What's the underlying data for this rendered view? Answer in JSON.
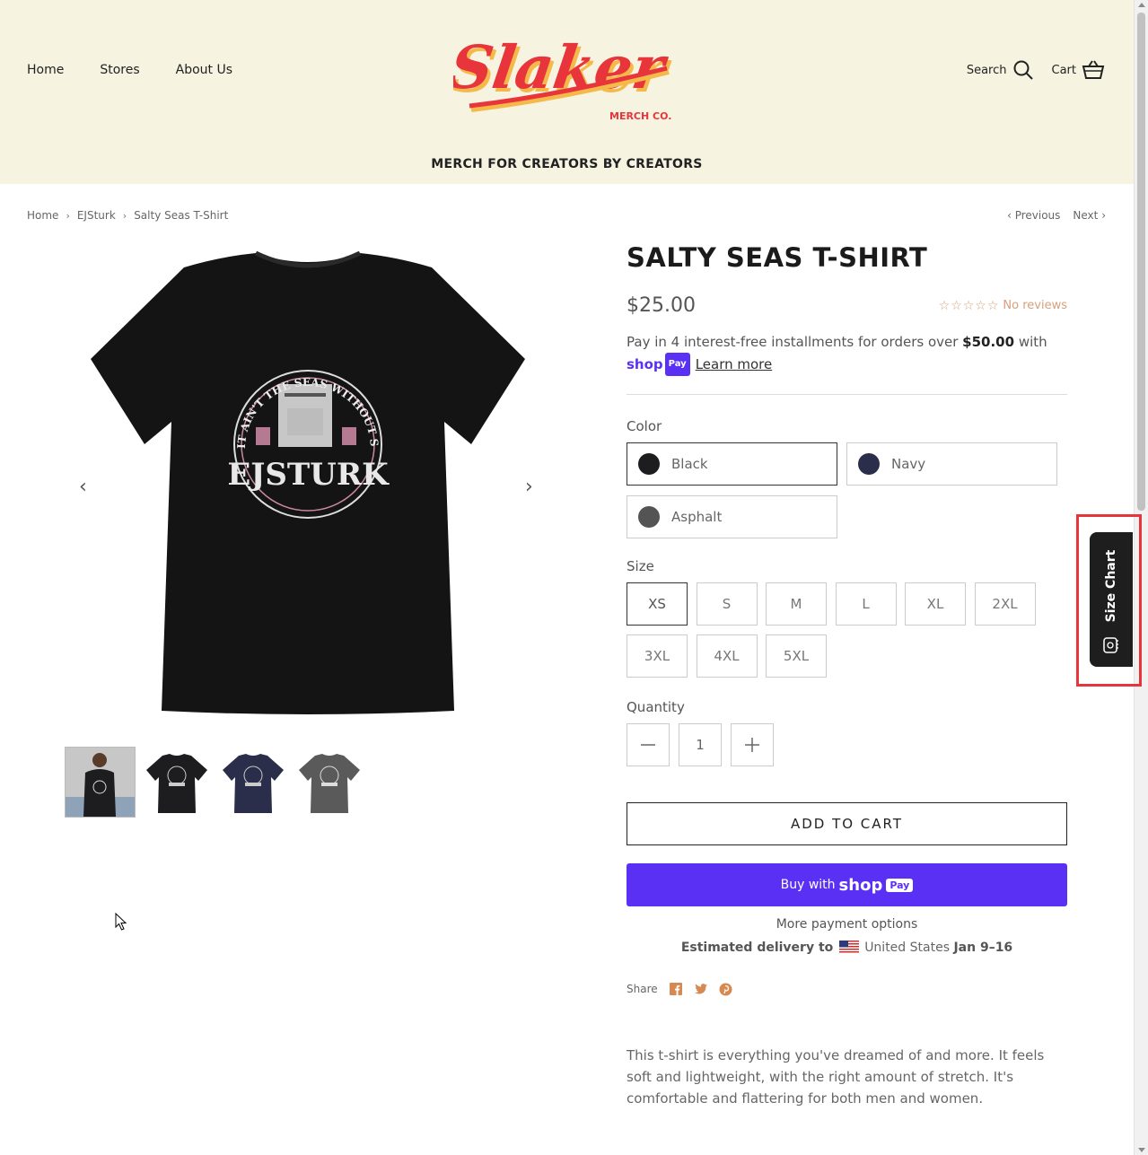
{
  "header": {
    "nav": [
      "Home",
      "Stores",
      "About Us"
    ],
    "logo_text": "Slaker",
    "logo_sub": "MERCH CO.",
    "tagline": "MERCH FOR CREATORS BY CREATORS",
    "search_label": "Search",
    "cart_label": "Cart"
  },
  "breadcrumb": {
    "items": [
      "Home",
      "EJSturk",
      "Salty Seas T-Shirt"
    ]
  },
  "pager": {
    "previous": "Previous",
    "next": "Next"
  },
  "product": {
    "title": "SALTY SEAS T-SHIRT",
    "price": "$25.00",
    "reviews": "No reviews",
    "stars": "☆☆☆☆☆",
    "installments_pre": "Pay in 4 interest-free installments for orders over ",
    "installments_amount": "$50.00",
    "installments_post": " with",
    "shop_word": "shop",
    "pay_word": "Pay",
    "learn_more": "Learn more",
    "color_label": "Color",
    "colors": [
      {
        "name": "Black",
        "hex": "#1d1d1f",
        "selected": true
      },
      {
        "name": "Navy",
        "hex": "#2a2e4a",
        "selected": false
      },
      {
        "name": "Asphalt",
        "hex": "#545454",
        "selected": false
      }
    ],
    "size_label": "Size",
    "sizes": [
      "XS",
      "S",
      "M",
      "L",
      "XL",
      "2XL",
      "3XL",
      "4XL",
      "5XL"
    ],
    "selected_size": "XS",
    "quantity_label": "Quantity",
    "quantity": "1",
    "add_to_cart": "ADD TO CART",
    "buy_with": "Buy with",
    "more_payment": "More payment options",
    "delivery_label": "Estimated delivery to",
    "delivery_country": "United States",
    "delivery_dates": "Jan 9–16",
    "share_label": "Share",
    "description": "This t-shirt is everything you've dreamed of and more. It feels soft and lightweight, with the right amount of stretch. It's comfortable and flattering for both men and women."
  },
  "shirt_print": {
    "arc_text": "IT AIN'T THE SEAS WITHOUT SOME SALT",
    "brand": "EJSTURK"
  },
  "gallery": {
    "thumb_colors": [
      "#1d1d1f",
      "#1d1d1f",
      "#2a2e4a",
      "#5a5a5a"
    ]
  },
  "size_chart_widget": {
    "label": "Size Chart"
  },
  "colors": {
    "accent": "#e8353b",
    "shoppay": "#5a31f4",
    "header_bg": "#f6f3e1"
  }
}
